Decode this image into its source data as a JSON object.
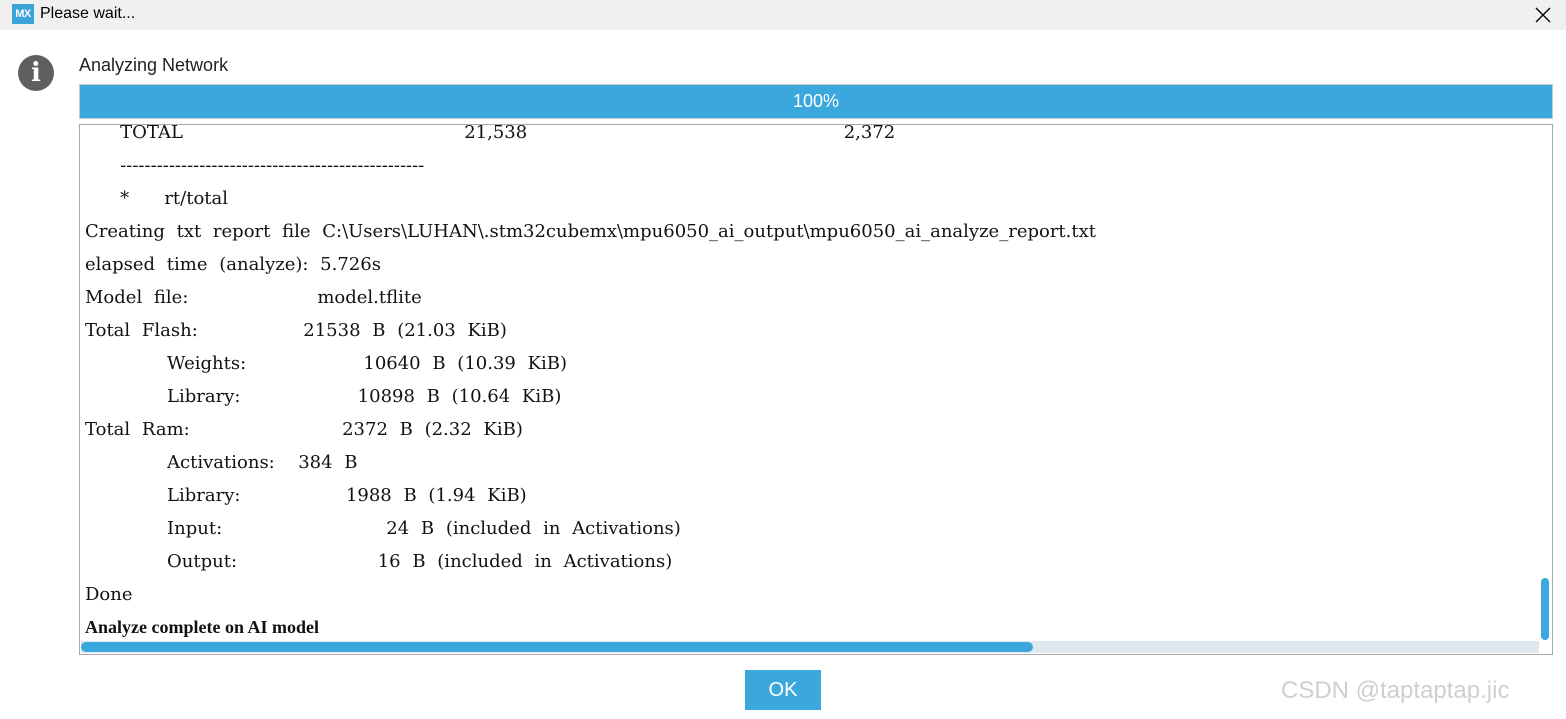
{
  "window": {
    "logo_text": "MX",
    "title": "Please wait...",
    "close_glyph": "×"
  },
  "dialog": {
    "info_icon_glyph": "i",
    "heading": "Analyzing Network",
    "progress_percent": 100,
    "progress_label": "100%",
    "ok_label": "OK"
  },
  "log": {
    "lines": [
      "   TOTAL                        21,538                           2,372",
      "   --------------------------------------------------",
      "   *   rt/total",
      "Creating txt report file C:\\Users\\LUHAN\\.stm32cubemx\\mpu6050_ai_output\\mpu6050_ai_analyze_report.txt",
      "elapsed time (analyze): 5.726s",
      "Model file:           model.tflite",
      "Total Flash:         21538 B (21.03 KiB)",
      "       Weights:          10640 B (10.39 KiB)",
      "       Library:          10898 B (10.64 KiB)",
      "Total Ram:             2372 B (2.32 KiB)",
      "       Activations:  384 B",
      "       Library:         1988 B (1.94 KiB)",
      "       Input:              24 B (included in Activations)",
      "       Output:            16 B (included in Activations)",
      "Done",
      "Analyze complete on AI model"
    ],
    "bold_line_index": 15,
    "vertical_scroll_fraction": 1.0,
    "horizontal_scroll_fraction": 0.0
  },
  "watermark": "CSDN @taptaptap.jic",
  "colors": {
    "accent": "#3ba8dd",
    "titlebar": "#f0f0f0",
    "info_icon": "#5f5f5f"
  }
}
